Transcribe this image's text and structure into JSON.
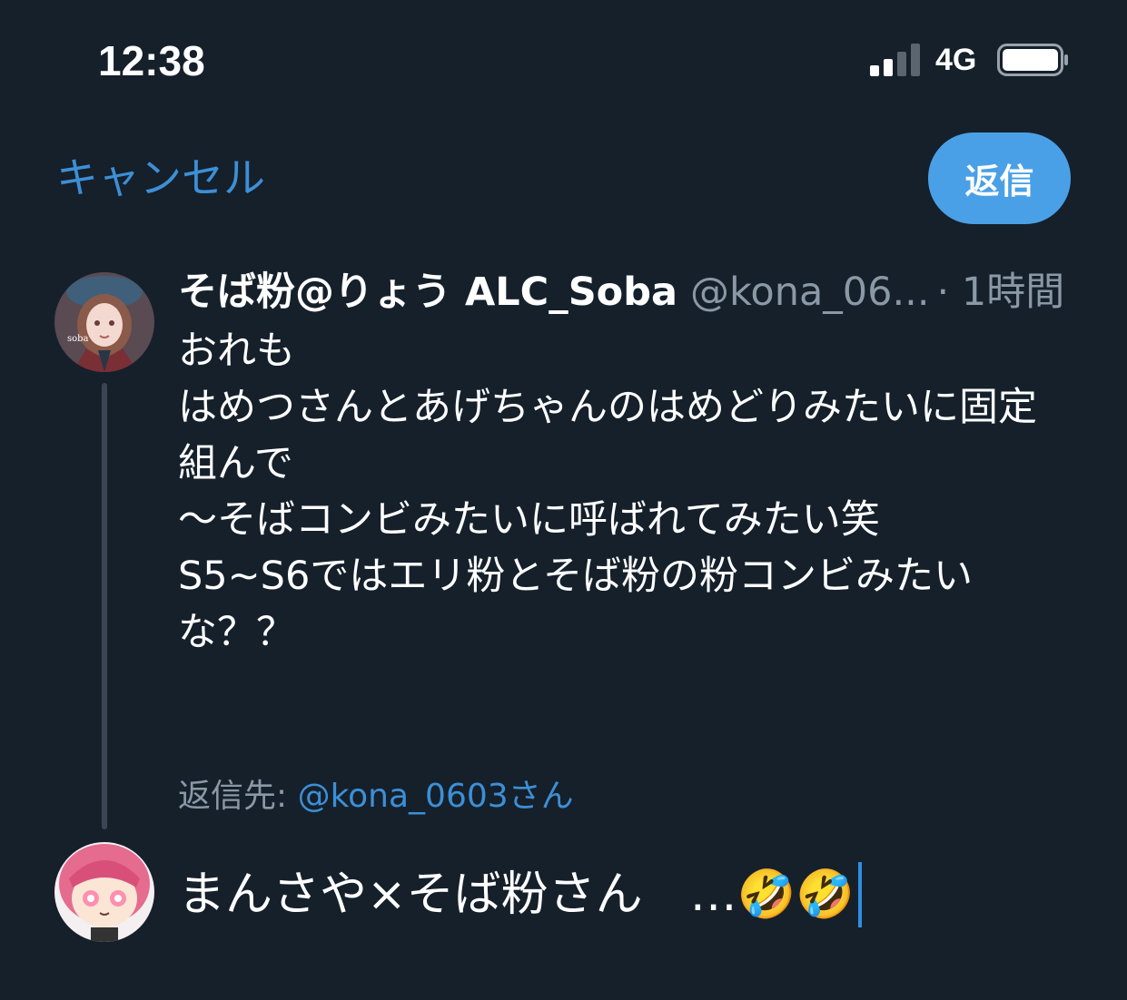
{
  "status_bar": {
    "time": "12:38",
    "network": "4G",
    "signal_bars_active": 2,
    "signal_bars_total": 4
  },
  "top_bar": {
    "cancel_label": "キャンセル",
    "reply_label": "返信"
  },
  "tweet": {
    "author_name": "そば粉@りょう ALC_Soba",
    "author_handle": "@kona_06...",
    "time": "· 1時間",
    "body": "おれも\nはめつさんとあげちゃんのはめどりみたいに固定\n組んで\n〜そばコンビみたいに呼ばれてみたい笑\nS5~S6ではエリ粉とそば粉の粉コンビみたい\nな？？",
    "avatar_text": "soba"
  },
  "reply_to": {
    "label": "返信先: ",
    "handle": "@kona_0603さん"
  },
  "composer": {
    "text": "まんさや×そば粉さん　…🤣🤣"
  },
  "colors": {
    "background": "#15202b",
    "accent": "#3d8fd6",
    "reply_button": "#4aa0e6",
    "muted": "#8b98a5"
  }
}
